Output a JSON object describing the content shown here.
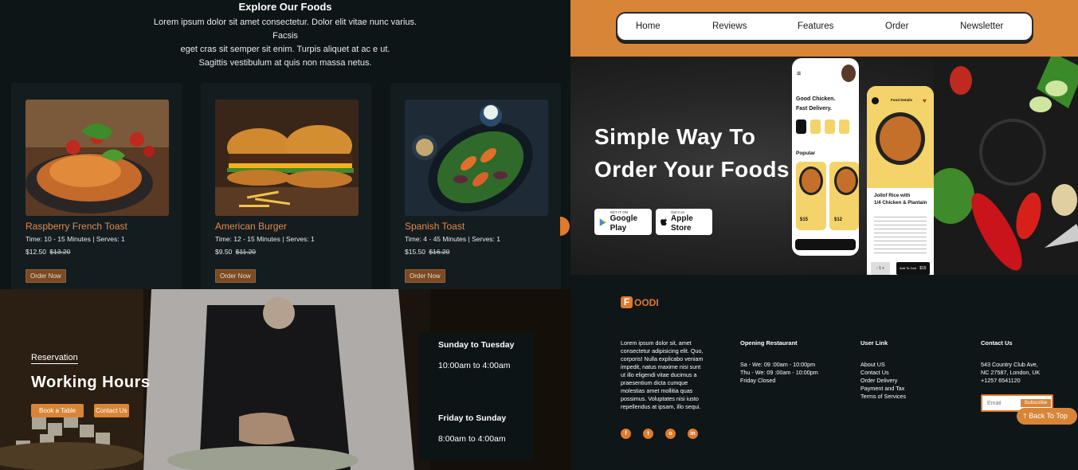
{
  "explore": {
    "title": "Explore Our Foods",
    "description_lines": [
      "Lorem ipsum dolor sit amet consectetur. Dolor elit vitae nunc varius. Facsis",
      "eget cras sit semper sit enim. Turpis aliquet at ac e ut.",
      "Sagittis vestibulum at quis non massa netus."
    ],
    "cards": [
      {
        "name": "Raspberry French Toast",
        "meta": "Time: 10 - 15 Minutes | Serves: 1",
        "price": "$12.50",
        "old_price": "$13.20",
        "button": "Order Now"
      },
      {
        "name": "American Burger",
        "meta": "Time: 12 - 15 Minutes | Serves: 1",
        "price": "$9.50",
        "old_price": "$11.20",
        "button": "Order Now"
      },
      {
        "name": "Spanish Toast",
        "meta": "Time: 4 - 45 Minutes | Serves: 1",
        "price": "$15.50",
        "old_price": "$16.20",
        "button": "Order Now"
      }
    ]
  },
  "nav": {
    "items": [
      "Home",
      "Reviews",
      "Features",
      "Order",
      "Newsletter"
    ]
  },
  "hero": {
    "title_line1": "Simple Way To",
    "title_line2": "Order Your Foods",
    "google_small": "GET IT ON",
    "google_big": "Google Play",
    "apple_small": "Get it on",
    "apple_big": "Apple Store",
    "phone1": {
      "greeting_line1": "Good Chicken.",
      "greeting_line2": "Fast Delivery.",
      "popular": "Popular",
      "price1": "$15",
      "price2": "$12"
    },
    "phone2": {
      "header": "Food Details",
      "dish_line1": "Jollof Rice with",
      "dish_line2": "1/4 Chicken & Plantain",
      "qty": "- 1 +",
      "cart": "Add To Cart",
      "price": "$15"
    }
  },
  "hours": {
    "label": "Reservation",
    "title": "Working Hours",
    "book_button": "Book a Table",
    "contact_button": "Contact Us",
    "day1": "Sunday to Tuesday",
    "time1": "10:00am to 4:00am",
    "day2": "Friday to Sunday",
    "time2": "8:00am to 4:00am"
  },
  "footer": {
    "logo_letter": "F",
    "logo_text": "OODI",
    "description_lines": [
      "Lorem ipsum dolor sit, amet",
      "consectetur adipisicing elit. Quo,",
      "corporis! Nulla explicabo veniam",
      "impedit, natus maxime nisi sunt",
      "ut illo eligendi vitae ducimus a",
      "praesentium dicta cumque",
      "molestias amet mollitia quas",
      "possimus. Voluptates nisi iusto",
      "repellendus at ipsam, illo sequi."
    ],
    "opening_title": "Opening Restaurant",
    "opening_lines": [
      "Sa - We: 09 :00am - 10:00pm",
      "Thu - We: 09 :00am - 10:00pm",
      "Friday Closed"
    ],
    "userlink_title": "User Link",
    "userlink_items": [
      "About US",
      "Contact Us",
      "Order Delivery",
      "Payment and Tax",
      "Terms of Services"
    ],
    "contact_title": "Contact Us",
    "contact_lines": [
      "543 Country Club Ave,",
      "NC 27587, London, UK",
      "+1257 6541120"
    ],
    "email_placeholder": "Email",
    "subscribe": "Subscribe",
    "back_to_top": "Back To Top",
    "socials": [
      "f",
      "t",
      "o",
      "in"
    ]
  }
}
